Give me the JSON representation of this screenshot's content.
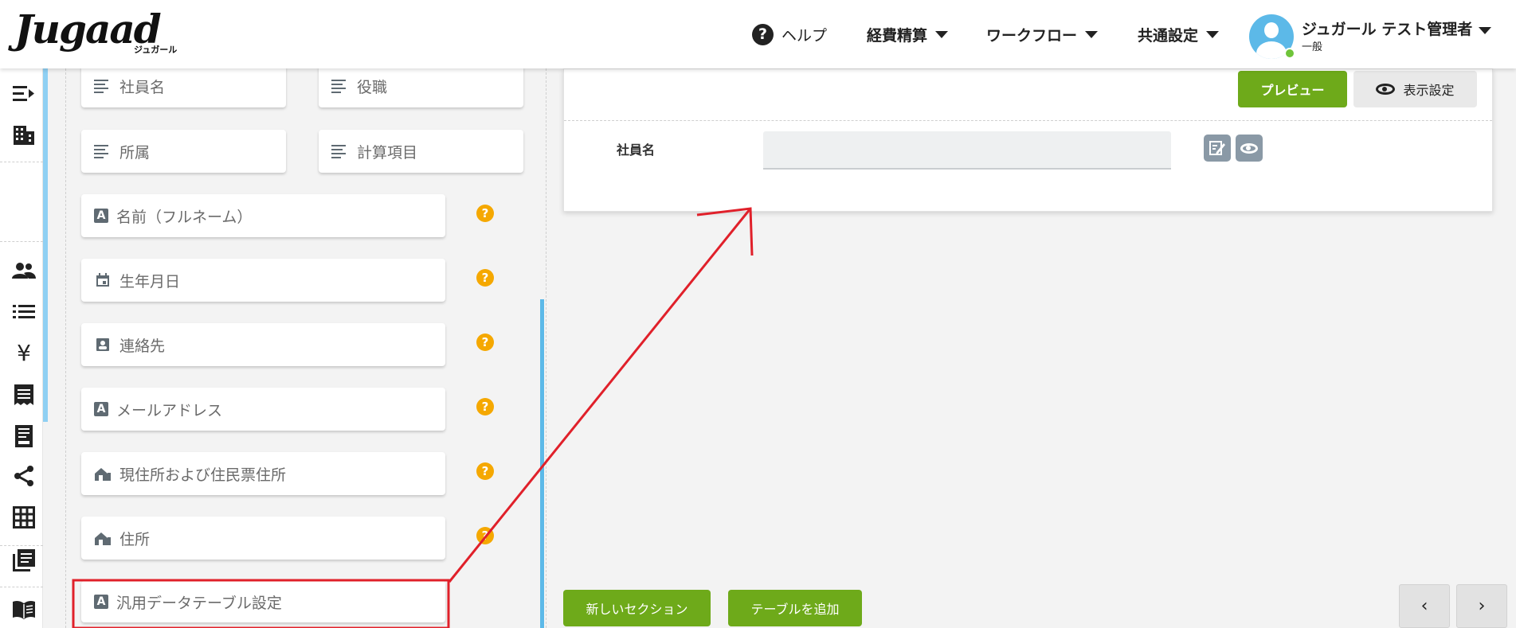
{
  "brand": {
    "logo_text": "Jugaad",
    "logo_sub": "ジュガール"
  },
  "nav": {
    "help": "ヘルプ",
    "expense": "経費精算",
    "workflow": "ワークフロー",
    "common_settings": "共通設定"
  },
  "user": {
    "name": "ジュガール テスト管理者",
    "role": "一般",
    "status_color": "#6fc43a"
  },
  "rail_icons": [
    "menu-collapse-icon",
    "building-icon",
    "people-icon",
    "list-icon",
    "yen-icon",
    "receipt-icon",
    "invoice-icon",
    "share-icon",
    "grid-icon",
    "library-icon",
    "book-icon"
  ],
  "palette": {
    "fields": [
      {
        "label": "社員名",
        "icon": "text-lines-icon"
      },
      {
        "label": "役職",
        "icon": "text-lines-icon"
      },
      {
        "label": "所属",
        "icon": "text-lines-icon"
      },
      {
        "label": "計算項目",
        "icon": "text-lines-icon"
      },
      {
        "label": "名前（フルネーム）",
        "icon": "text-a-icon"
      },
      {
        "label": "生年月日",
        "icon": "calendar-icon"
      },
      {
        "label": "連絡先",
        "icon": "contact-icon"
      },
      {
        "label": "メールアドレス",
        "icon": "text-a-icon"
      },
      {
        "label": "現住所および住民票住所",
        "icon": "home-icon"
      },
      {
        "label": "住所",
        "icon": "home-icon"
      },
      {
        "label": "汎用データテーブル設定",
        "icon": "text-a-icon"
      }
    ],
    "help_mark": "?"
  },
  "form": {
    "preview_label": "プレビュー",
    "display_settings_label": "表示設定",
    "row_label": "社員名",
    "row_value": ""
  },
  "footer": {
    "new_section_label": "新しいセクション",
    "add_table_label": "テーブルを追加",
    "prev": "‹",
    "next": "›"
  },
  "colors": {
    "accent_green": "#6eaa1a",
    "help_orange": "#f5a800",
    "rail_accent": "#8fd0f3",
    "annotation_red": "#e0202a"
  }
}
